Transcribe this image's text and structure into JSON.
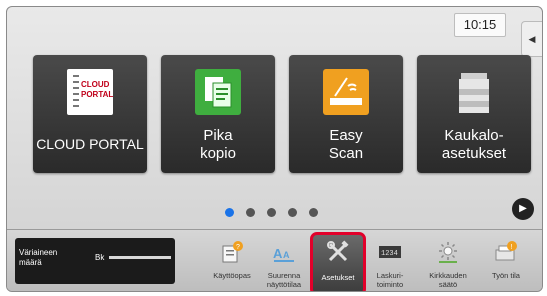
{
  "clock": "10:15",
  "side_tab_icon": "◀",
  "apps": [
    {
      "name": "CLOUD PORTAL",
      "label_lines": [
        "CLOUD PORTAL"
      ],
      "icon": "cloud-portal-icon"
    },
    {
      "name": "Pika kopio",
      "label_lines": [
        "Pika",
        "kopio"
      ],
      "icon": "copy-icon"
    },
    {
      "name": "Easy Scan",
      "label_lines": [
        "Easy",
        "Scan"
      ],
      "icon": "scan-icon"
    },
    {
      "name": "Kaukaloasetukset",
      "label_lines": [
        "Kaukalo-",
        "asetukset"
      ],
      "icon": "printer-icon"
    }
  ],
  "cloud_logo_text": [
    "CLOUD",
    "PORTAL"
  ],
  "pager": {
    "count": 5,
    "active": 0
  },
  "toner": {
    "label_line1": "Väriaineen",
    "label_line2": "määrä",
    "color_label": "Bk",
    "level": 1.0
  },
  "bottom_buttons": [
    {
      "label_line1": "Käyttöopas",
      "label_line2": "",
      "icon": "guide-icon"
    },
    {
      "label_line1": "Suurenna",
      "label_line2": "näyttötilaa",
      "icon": "magnify-icon"
    },
    {
      "label_line1": "Asetukset",
      "label_line2": "",
      "icon": "settings-icon",
      "selected": true
    },
    {
      "label_line1": "Laskuri-",
      "label_line2": "toiminto",
      "icon": "counter-icon"
    },
    {
      "label_line1": "Kirkkauden",
      "label_line2": "säätö",
      "icon": "brightness-icon"
    },
    {
      "label_line1": "Työn tila",
      "label_line2": "",
      "icon": "job-status-icon"
    }
  ],
  "colors": {
    "accent": "#1a73e8",
    "highlight": "#e2002a"
  }
}
